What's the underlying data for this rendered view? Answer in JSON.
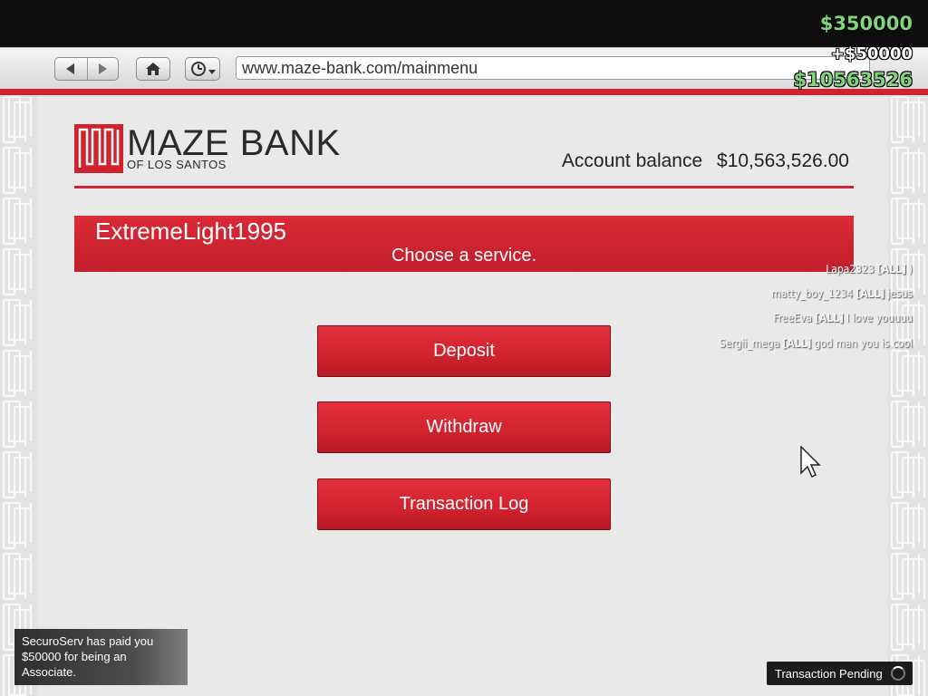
{
  "hud": {
    "cash": "$350000",
    "gain": "+$50000",
    "bank": "$10563526"
  },
  "browser": {
    "url": "www.maze-bank.com/mainmenu",
    "icons": [
      "back-arrow-icon",
      "forward-arrow-icon",
      "home-icon",
      "history-clock-icon"
    ]
  },
  "bank": {
    "name": "MAZE BANK",
    "subtitle": "OF LOS SANTOS",
    "balance_label": "Account balance",
    "balance_value": "$10,563,526.00",
    "username": "ExtremeLight1995",
    "prompt": "Choose a service.",
    "buttons": [
      "Deposit",
      "Withdraw",
      "Transaction Log"
    ],
    "brand_color": "#d1222e"
  },
  "chat": [
    {
      "user": "Lapa2323",
      "tag": "[ALL]",
      "message": ")"
    },
    {
      "user": "matty_boy_1234",
      "tag": "[ALL]",
      "message": "jesus"
    },
    {
      "user": "FreeEva",
      "tag": "[ALL]",
      "message": "I love youuuu"
    },
    {
      "user": "Sergii_mega",
      "tag": "[ALL]",
      "message": "god man you is cool"
    }
  ],
  "notification": "SecuroServ has paid you $50000 for being an Associate.",
  "status": "Transaction Pending"
}
